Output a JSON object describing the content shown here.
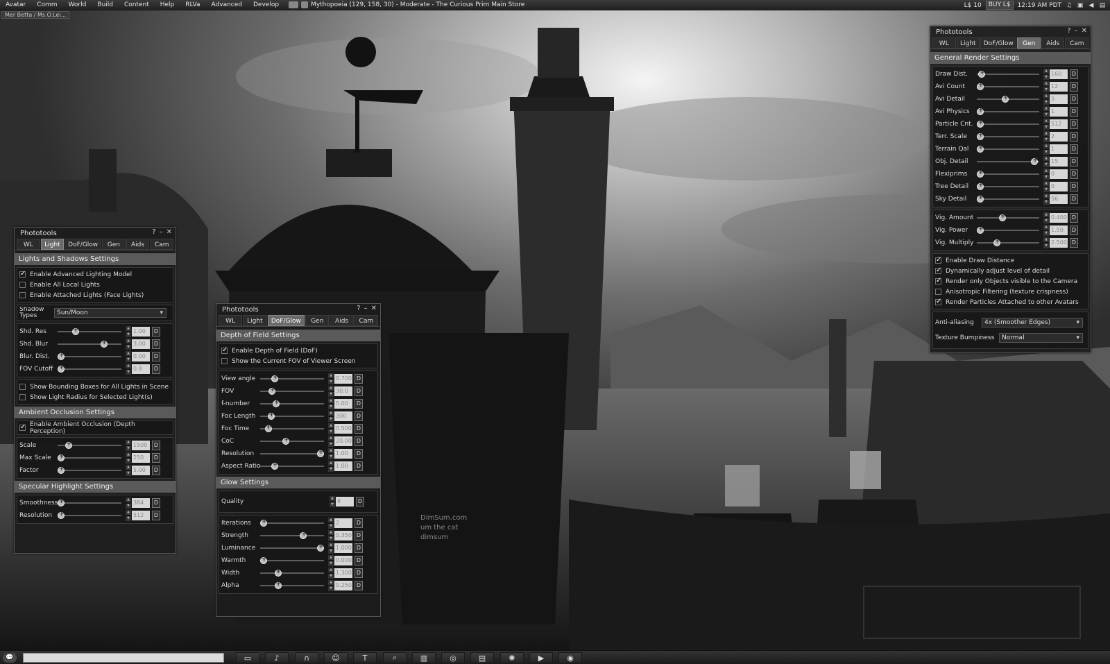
{
  "menu": [
    "Avatar",
    "Comm",
    "World",
    "Build",
    "Content",
    "Help",
    "RLVa",
    "Advanced",
    "Develop"
  ],
  "location": "Mythopoeia (129, 158, 30) - Moderate - The Curious Prim Main Store",
  "status": {
    "balance": "L$ 10",
    "buy": "BUY L$",
    "time": "12:19 AM PDT"
  },
  "nametag": "Mer Betta / Ms.O.Lei...",
  "watermark": [
    "DimSum.com",
    "um the cat",
    "dimsum"
  ],
  "floater_light": {
    "title": "Phototools",
    "tabs": [
      "WL",
      "Light",
      "DoF/Glow",
      "Gen",
      "Aids",
      "Cam"
    ],
    "sections": {
      "lights": "Lights and Shadows Settings",
      "ao": "Ambient Occlusion Settings",
      "spec": "Specular Highlight Settings"
    },
    "checks1": [
      {
        "label": "Enable Advanced Lighting Model",
        "on": true
      },
      {
        "label": "Enable All Local Lights",
        "on": false
      },
      {
        "label": "Enable Attached Lights (Face Lights)",
        "on": false
      }
    ],
    "shadow_label": "Shadow Types",
    "shadow_value": "Sun/Moon",
    "sliders1": [
      {
        "label": "Shd. Res",
        "value": "1.00",
        "pos": 0.25
      },
      {
        "label": "Shd. Blur",
        "value": "3.00",
        "pos": 0.75
      },
      {
        "label": "Blur. Dist.",
        "value": "0.00",
        "pos": 0.0
      },
      {
        "label": "FOV Cutoff",
        "value": "0.8",
        "pos": 0.0
      }
    ],
    "checks2": [
      {
        "label": "Show Bounding Boxes for All Lights in Scene",
        "on": false
      },
      {
        "label": "Show Light Radius for Selected Light(s)",
        "on": false
      }
    ],
    "ao_check": {
      "label": "Enable Ambient Occlusion (Depth Perception)",
      "on": true
    },
    "sliders2": [
      {
        "label": "Scale",
        "value": "1500",
        "pos": 0.13
      },
      {
        "label": "Max Scale",
        "value": "250",
        "pos": 0.0
      },
      {
        "label": "Factor",
        "value": "5.00",
        "pos": 0.0
      }
    ],
    "sliders3": [
      {
        "label": "Smoothness",
        "value": "384",
        "pos": 0.0
      },
      {
        "label": "Resolution",
        "value": "512",
        "pos": 0.0
      }
    ]
  },
  "floater_dof": {
    "title": "Phototools",
    "tabs": [
      "WL",
      "Light",
      "DoF/Glow",
      "Gen",
      "Aids",
      "Cam"
    ],
    "section_dof": "Depth of Field Settings",
    "checks": [
      {
        "label": "Enable Depth of Field (DoF)",
        "on": true
      },
      {
        "label": "Show the Current FOV of Viewer Screen",
        "on": false
      }
    ],
    "sliders": [
      {
        "label": "View angle",
        "value": "0.700",
        "pos": 0.2
      },
      {
        "label": "FOV",
        "value": "30.0",
        "pos": 0.15
      },
      {
        "label": "f-number",
        "value": "5.00",
        "pos": 0.22
      },
      {
        "label": "Foc Length",
        "value": "300",
        "pos": 0.13
      },
      {
        "label": "Foc Time",
        "value": "0.500",
        "pos": 0.08
      },
      {
        "label": "CoC",
        "value": "20.00",
        "pos": 0.39
      },
      {
        "label": "Resolution",
        "value": "1.00",
        "pos": 1.0
      },
      {
        "label": "Aspect Ratio",
        "value": "1.00",
        "pos": 0.19
      }
    ],
    "section_glow": "Glow Settings",
    "quality_label": "Quality",
    "quality_value": "8",
    "glow_sliders": [
      {
        "label": "Iterations",
        "value": "2",
        "pos": 0.0
      },
      {
        "label": "Strength",
        "value": "0.350",
        "pos": 0.7
      },
      {
        "label": "Luminance",
        "value": "1.000",
        "pos": 1.0
      },
      {
        "label": "Warmth",
        "value": "0.000",
        "pos": 0.0
      },
      {
        "label": "Width",
        "value": "1.300",
        "pos": 0.25
      },
      {
        "label": "Alpha",
        "value": "0.250",
        "pos": 0.25
      }
    ]
  },
  "floater_gen": {
    "title": "Phototools",
    "tabs": [
      "WL",
      "Light",
      "DoF/Glow",
      "Gen",
      "Aids",
      "Cam"
    ],
    "section": "General Render Settings",
    "sliders": [
      {
        "label": "Draw Dist.",
        "value": "160",
        "pos": 0.03
      },
      {
        "label": "Avi Count",
        "value": "12",
        "pos": 0.0
      },
      {
        "label": "Avi Detail",
        "value": "5",
        "pos": 0.45
      },
      {
        "label": "Avi Physics",
        "value": "1",
        "pos": 0.0
      },
      {
        "label": "Particle Cnt.",
        "value": "512",
        "pos": 0.0
      },
      {
        "label": "Terr. Scale",
        "value": "2",
        "pos": 0.0
      },
      {
        "label": "Terrain Qal",
        "value": "1",
        "pos": 0.0
      },
      {
        "label": "Obj. Detail",
        "value": "15",
        "pos": 0.98
      },
      {
        "label": "Flexiprims",
        "value": "0",
        "pos": 0.0
      },
      {
        "label": "Tree Detail",
        "value": "0",
        "pos": 0.0
      },
      {
        "label": "Sky Detail",
        "value": "56",
        "pos": 0.0
      }
    ],
    "vig_sliders": [
      {
        "label": "Vig. Amount",
        "value": "0.400",
        "pos": 0.4
      },
      {
        "label": "Vig. Power",
        "value": "1.50",
        "pos": 0.0
      },
      {
        "label": "Vig. Multiply",
        "value": "2.500",
        "pos": 0.3
      }
    ],
    "checks": [
      {
        "label": "Enable Draw Distance",
        "on": true
      },
      {
        "label": "Dynamically adjust level of detail",
        "on": true
      },
      {
        "label": "Render only Objects visible to the Camera",
        "on": true
      },
      {
        "label": "Anisotropic Filtering (texture crispness)",
        "on": false
      },
      {
        "label": "Render Particles Attached to other Avatars",
        "on": true
      }
    ],
    "aa_label": "Anti-aliasing",
    "aa_value": "4x (Smoother Edges)",
    "bump_label": "Texture Bumpiness",
    "bump_value": "Normal"
  },
  "toolbar_icons": [
    "conversations-icon",
    "voice-icon",
    "speak-icon",
    "people-icon",
    "build-icon",
    "search-icon",
    "map-icon",
    "minimap-icon",
    "inventory-icon",
    "snapshot-icon",
    "camera-icon",
    "photo-icon"
  ]
}
